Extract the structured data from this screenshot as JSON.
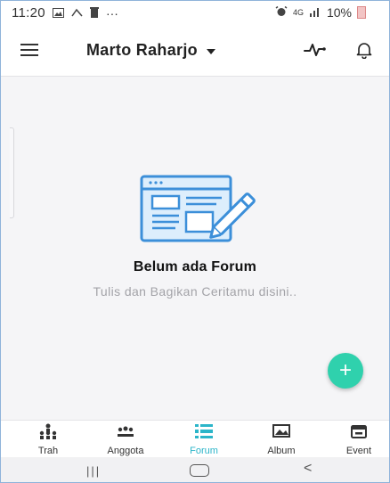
{
  "status_bar": {
    "time": "11:20",
    "dots": "···",
    "network": "4G",
    "battery_percent": "10%"
  },
  "header": {
    "title": "Marto Raharjo"
  },
  "empty_state": {
    "title": "Belum ada Forum",
    "subtitle": "Tulis dan Bagikan Ceritamu disini.."
  },
  "fab": {
    "label": "+"
  },
  "bottom_nav": {
    "items": [
      {
        "label": "Trah",
        "icon": "family-tree-icon"
      },
      {
        "label": "Anggota",
        "icon": "members-icon"
      },
      {
        "label": "Forum",
        "icon": "forum-icon",
        "active": true
      },
      {
        "label": "Album",
        "icon": "album-icon"
      },
      {
        "label": "Event",
        "icon": "event-icon"
      }
    ]
  },
  "system_nav": {
    "recent": "|||",
    "back": "<"
  },
  "colors": {
    "accent": "#2bb5c9",
    "fab": "#2fd1ad",
    "illustration_blue": "#3c8fd9"
  }
}
